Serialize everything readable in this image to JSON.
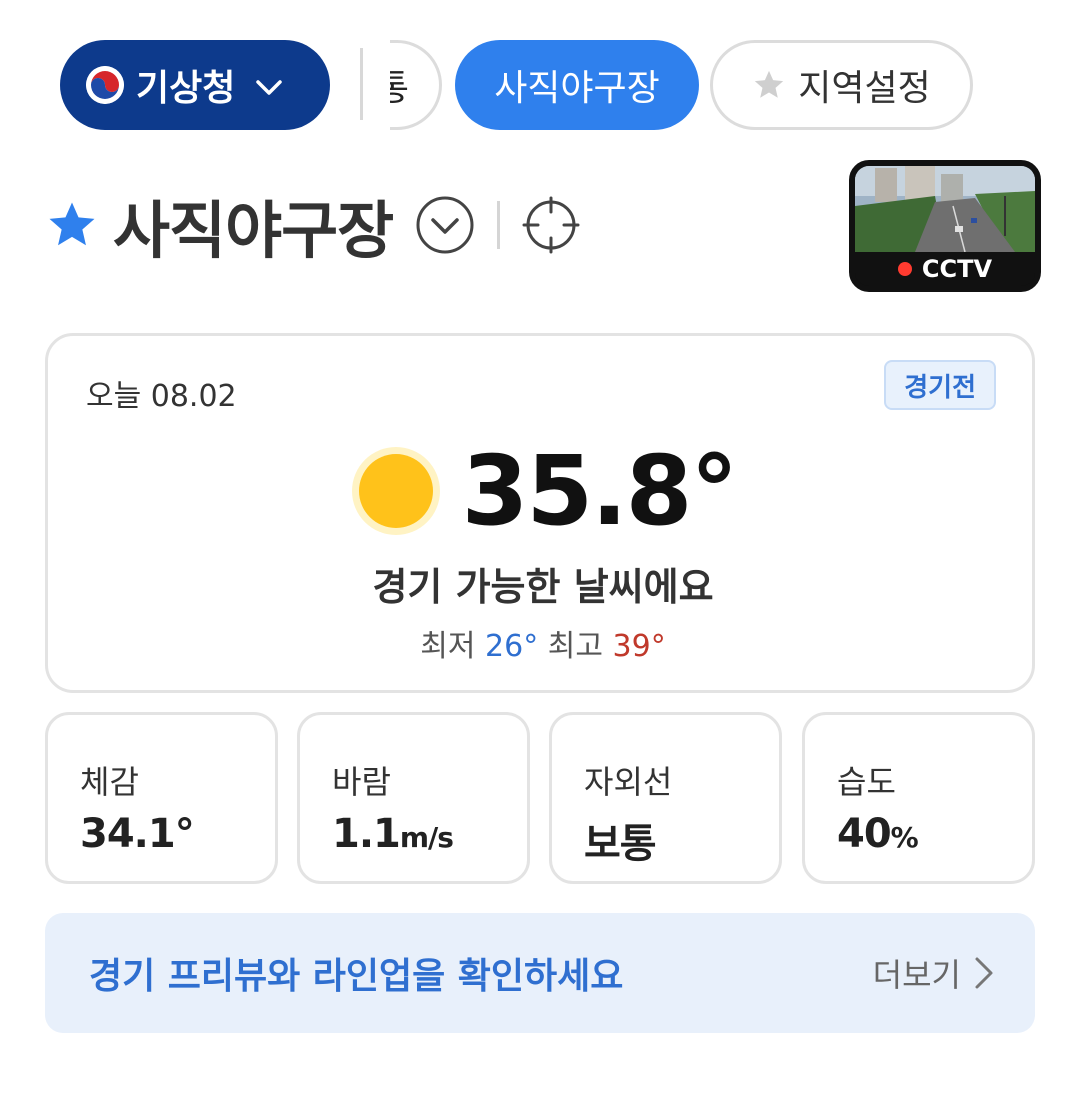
{
  "chips": {
    "source_label": "기상청",
    "partial_label": "통",
    "active_label": "사직야구장",
    "region_label": "지역설정"
  },
  "icons": {
    "source_logo": "kma-logo-icon",
    "source_chevron": "chevron-down-icon",
    "region_star": "star-icon",
    "title_star": "star-icon",
    "title_dropdown": "chevron-down-circle-icon",
    "locate": "crosshair-icon",
    "weather": "sun-icon",
    "more_arrow": "chevron-right-icon"
  },
  "title": {
    "name": "사직야구장"
  },
  "cctv": {
    "label": "CCTV"
  },
  "today": {
    "date": "오늘 08.02",
    "badge": "경기전",
    "temperature": "35.8°",
    "condition": "경기 가능한 날씨에요",
    "min_label": "최저",
    "min_value": "26°",
    "max_label": "최고",
    "max_value": "39°"
  },
  "stats": [
    {
      "label": "체감",
      "value": "34.1°",
      "unit": ""
    },
    {
      "label": "바람",
      "value": "1.1",
      "unit": "m/s"
    },
    {
      "label": "자외선",
      "value": "보통",
      "unit": ""
    },
    {
      "label": "습도",
      "value": "40",
      "unit": "%"
    }
  ],
  "banner": {
    "text": "경기 프리뷰와 라인업을 확인하세요",
    "more": "더보기"
  },
  "colors": {
    "source_chip": "#0d3a8c",
    "active_chip": "#2f80ed",
    "accent_blue": "#2f6fd0",
    "max_red": "#c0392b",
    "sun": "#ffc21a",
    "banner_bg": "#e8f0fb"
  }
}
